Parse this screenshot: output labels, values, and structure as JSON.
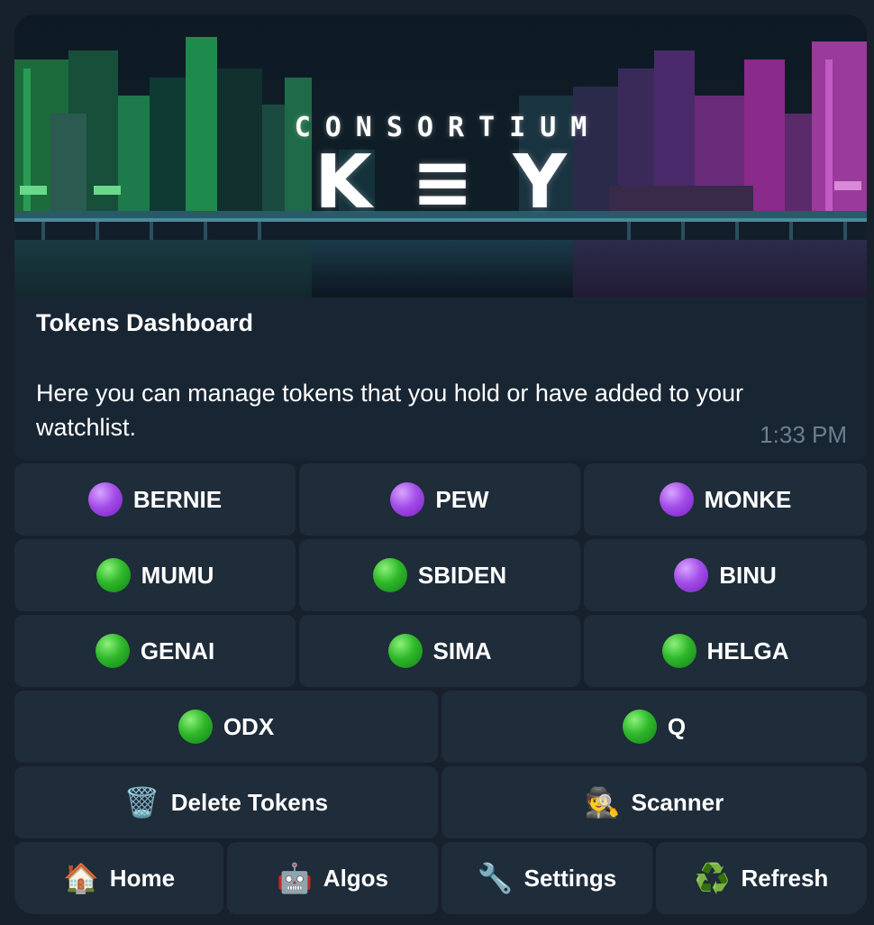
{
  "banner": {
    "brand_top": "CONSORTIUM",
    "brand_main": "K≡Y"
  },
  "message": {
    "title": "Tokens Dashboard",
    "body": "Here you can manage tokens that you hold or have added to your watchlist.",
    "time": "1:33 PM"
  },
  "tokens": [
    {
      "label": "BERNIE",
      "status": "purple"
    },
    {
      "label": "PEW",
      "status": "purple"
    },
    {
      "label": "MONKE",
      "status": "purple"
    },
    {
      "label": "MUMU",
      "status": "green"
    },
    {
      "label": "SBIDEN",
      "status": "green"
    },
    {
      "label": "BINU",
      "status": "purple"
    },
    {
      "label": "GENAI",
      "status": "green"
    },
    {
      "label": "SIMA",
      "status": "green"
    },
    {
      "label": "HELGA",
      "status": "green"
    },
    {
      "label": "ODX",
      "status": "green"
    },
    {
      "label": "Q",
      "status": "green"
    }
  ],
  "actions": {
    "delete": {
      "icon": "🗑️",
      "label": "Delete Tokens"
    },
    "scanner": {
      "icon": "🕵️",
      "label": "Scanner"
    },
    "home": {
      "icon": "🏠",
      "label": "Home"
    },
    "algos": {
      "icon": "🤖",
      "label": "Algos"
    },
    "settings": {
      "icon": "🔧",
      "label": "Settings"
    },
    "refresh": {
      "icon": "♻️",
      "label": "Refresh"
    }
  },
  "colors": {
    "background": "#17212b",
    "bubble": "#182533",
    "button": "#1f2c39",
    "time": "#6d7f8f",
    "status_purple": "#a34ee8",
    "status_green": "#2fb82a"
  }
}
